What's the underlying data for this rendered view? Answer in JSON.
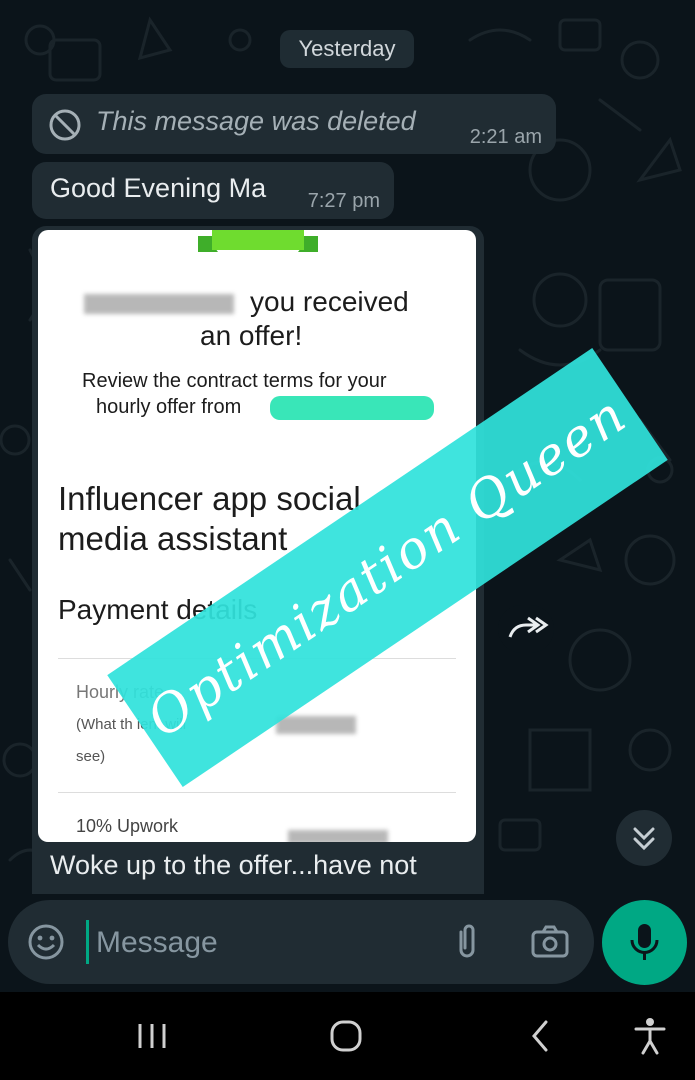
{
  "chat": {
    "date_separator": "Yesterday",
    "messages": [
      {
        "text": "This message was deleted",
        "time": "2:21 am"
      },
      {
        "text": "Good Evening Ma",
        "time": "7:27 pm"
      }
    ],
    "image_message": {
      "screenshot": {
        "title_line1": "you received",
        "title_line2": "an offer!",
        "subtitle_line1": "Review the contract terms for your",
        "subtitle_line2": "hourly offer from",
        "job_title_line1": "Influencer app social",
        "job_title_line2": "media assistant",
        "section": "Payment details",
        "row1_label": "Hourly rate",
        "row1_sub": "(What th    ient will",
        "row1_sub2": "see)",
        "row2_label": "10% Upwork"
      },
      "watermark": "Optimization Queen",
      "caption_line1": "Woke up to the offer...have not"
    }
  },
  "composer": {
    "placeholder": "Message"
  },
  "icons": {
    "deleted": "block-icon",
    "emoji": "emoji-icon",
    "attach": "paperclip-icon",
    "camera": "camera-icon",
    "mic": "mic-icon",
    "forward": "forward-icon",
    "scroll_down": "double-chevron-down-icon"
  },
  "colors": {
    "background": "#0b141a",
    "bubble": "#202c33",
    "accent": "#00a884",
    "watermark": "#30e2db"
  }
}
